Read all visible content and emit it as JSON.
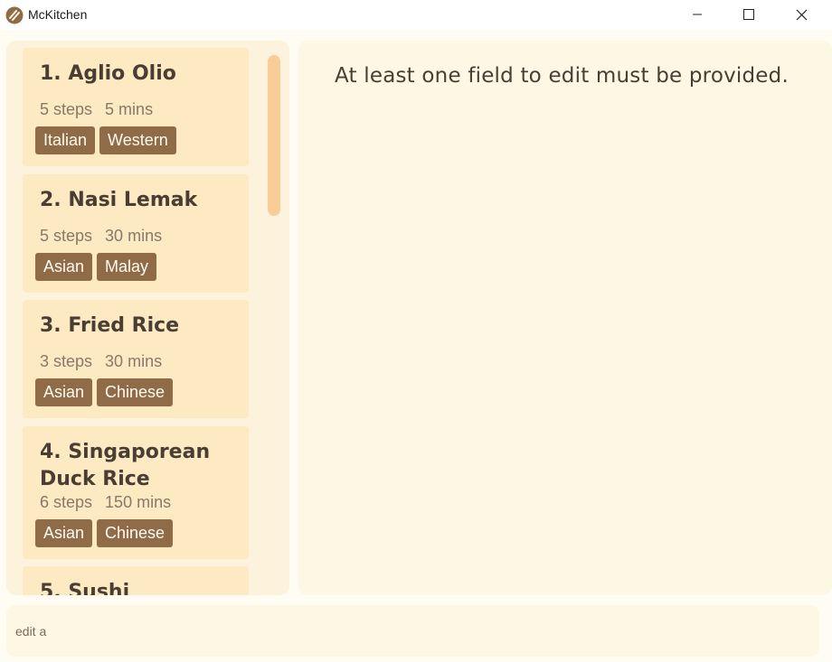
{
  "window": {
    "title": "McKitchen"
  },
  "recipes": [
    {
      "title": "1. Aglio Olio",
      "steps": "5 steps",
      "time": "5 mins",
      "tags": [
        "Italian",
        "Western"
      ]
    },
    {
      "title": "2. Nasi Lemak",
      "steps": "5 steps",
      "time": "30 mins",
      "tags": [
        "Asian",
        "Malay"
      ]
    },
    {
      "title": "3. Fried Rice",
      "steps": "3 steps",
      "time": "30 mins",
      "tags": [
        "Asian",
        "Chinese"
      ]
    },
    {
      "title": "4. Singaporean Duck Rice",
      "steps": "6 steps",
      "time": "150 mins",
      "tags": [
        "Asian",
        "Chinese"
      ]
    },
    {
      "title": "5. Sushi"
    }
  ],
  "result": {
    "message": "At least one field to edit must be provided."
  },
  "command": {
    "value": "edit a"
  },
  "colors": {
    "card": "#fde9c2",
    "tag": "#8f6b47",
    "panel": "#fdf3dc",
    "scrollbar": "#f9cc98",
    "text": "#4a3d33"
  }
}
